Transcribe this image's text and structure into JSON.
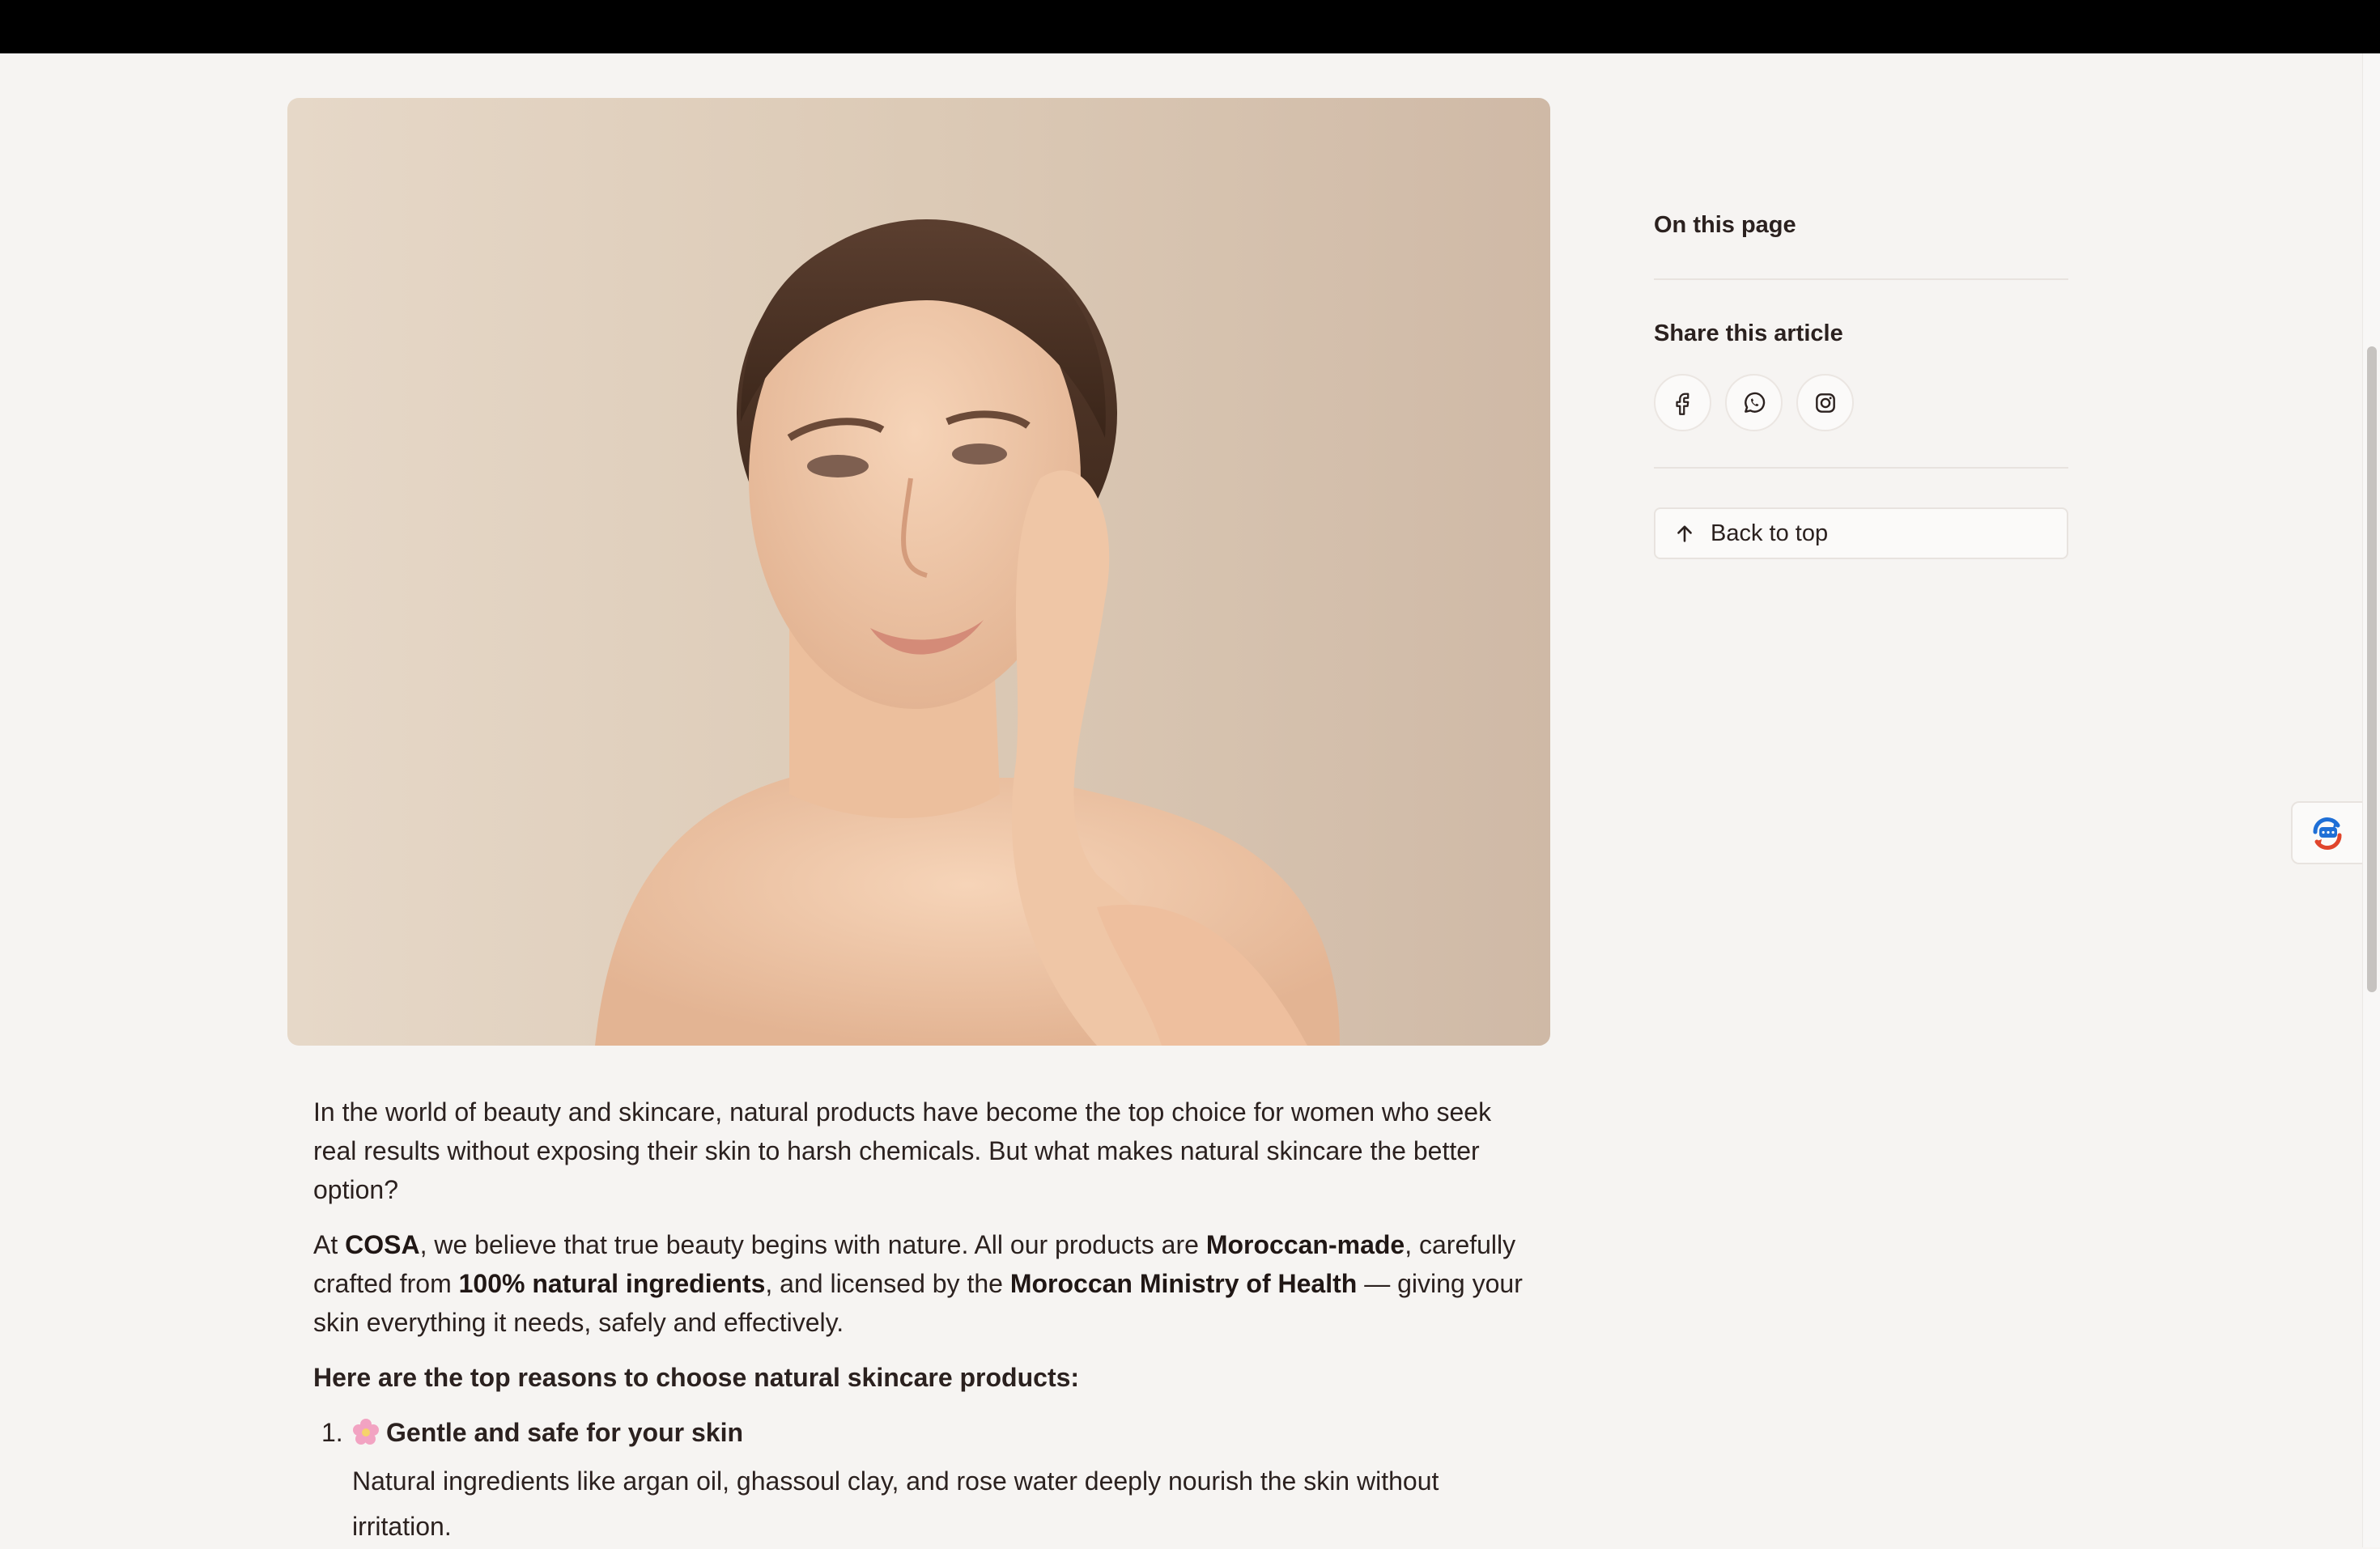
{
  "hero": {
    "alt": "Woman with smooth glowing skin touching her face"
  },
  "sidebar": {
    "on_this_page": "On this page",
    "share_title": "Share this article",
    "share_icons": [
      "facebook-icon",
      "whatsapp-icon",
      "instagram-icon"
    ],
    "back_to_top": "Back to top"
  },
  "article": {
    "p1": "In the world of beauty and skincare, natural products have become the top choice for women who seek real results without exposing their skin to harsh chemicals. But what makes natural skincare the better option?",
    "p2": {
      "t1": "At ",
      "b1": "COSA",
      "t2": ", we believe that true beauty begins with nature. All our products are ",
      "b2": "Moroccan-made",
      "t3": ", carefully crafted from ",
      "b3": "100% natural ingredients",
      "t4": ", and licensed by the ",
      "b4": "Moroccan Ministry of Health",
      "t5": " — giving your skin everything it needs, safely and effectively."
    },
    "heading": "Here are the top reasons to choose natural skincare products:",
    "list": [
      {
        "number": "1.",
        "emoji": "flower-icon",
        "title": "Gentle and safe for your skin",
        "body": "Natural ingredients like argan oil, ghassoul clay, and rose water deeply nourish the skin without irritation."
      }
    ]
  },
  "colors": {
    "background": "#f6f4f2",
    "text": "#2b211f",
    "divider": "#e8e3df",
    "top_bar": "#000000"
  }
}
